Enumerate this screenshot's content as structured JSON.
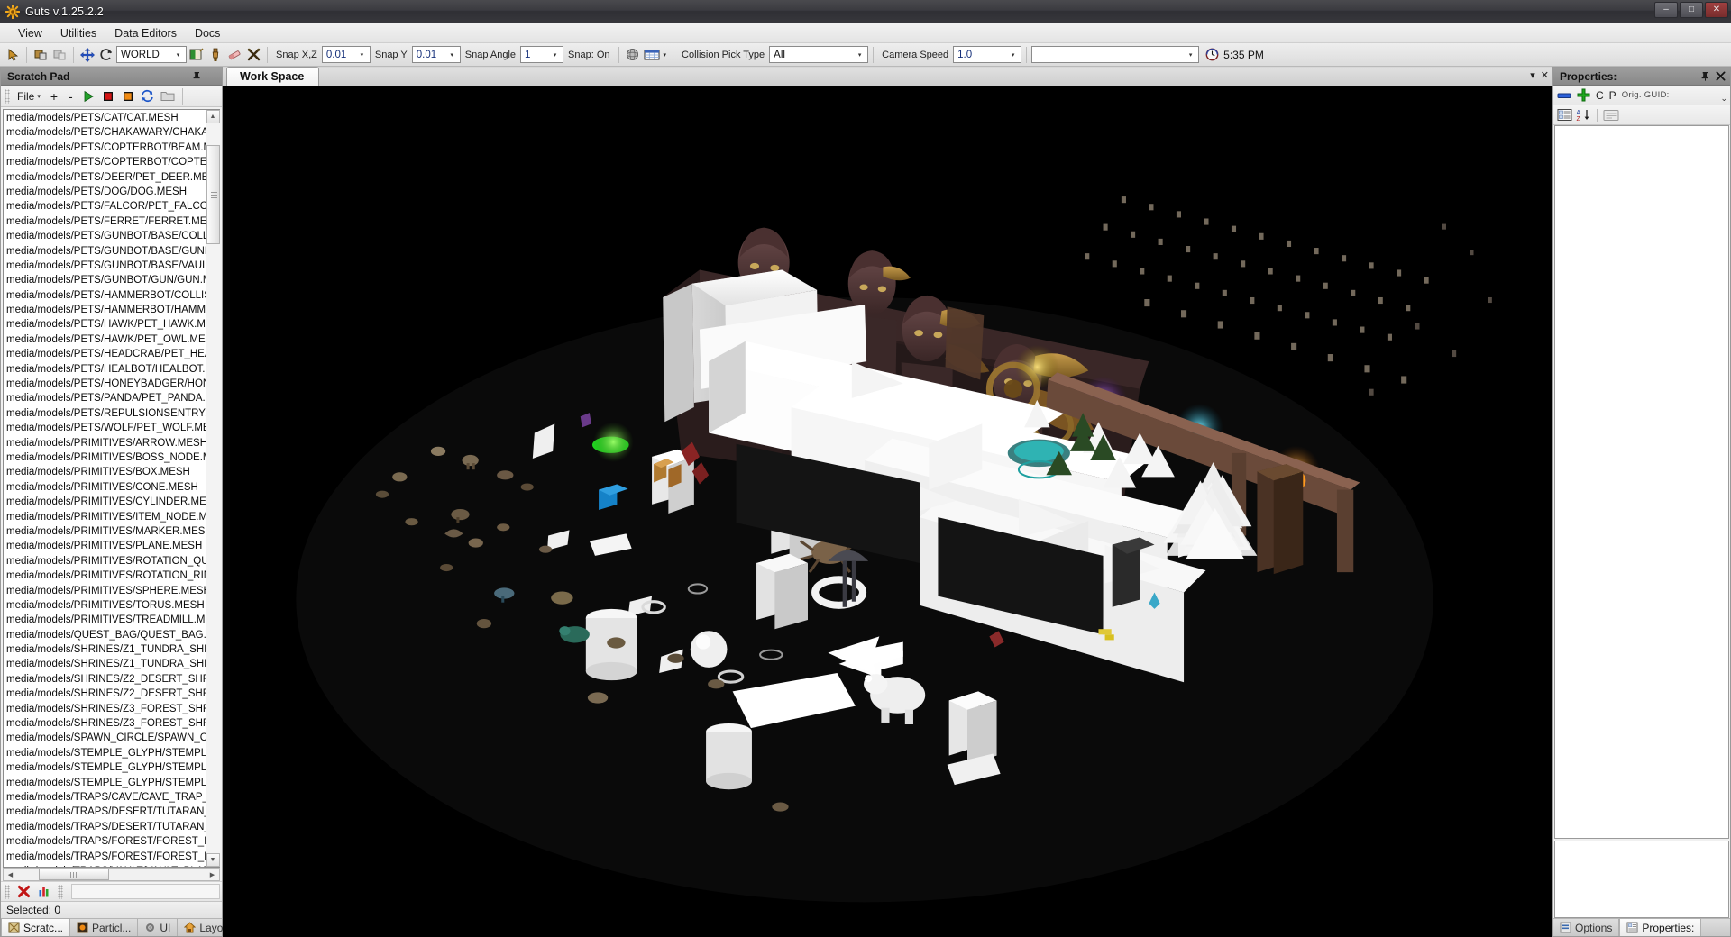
{
  "window": {
    "title": "Guts v.1.25.2.2",
    "app_icon": "gear-sun-icon",
    "minimize": "–",
    "maximize": "□",
    "close": "✕"
  },
  "menubar": {
    "items": [
      {
        "label": "View"
      },
      {
        "label": "Utilities"
      },
      {
        "label": "Data Editors"
      },
      {
        "label": "Docs"
      }
    ]
  },
  "toolbar": {
    "select_tool": "cursor-icon",
    "group_tool": "group-icon",
    "ungroup_tool": "ungroup-icon",
    "move_tool": "move-icon",
    "rotate_tool": "rotate-icon",
    "space_combo": {
      "value": "WORLD",
      "arrow": "▾"
    },
    "paint_tool": "paint-bucket-icon",
    "brush_tool": "brush-icon",
    "eraser_tool": "eraser-icon",
    "delete_tool": "scissors-x-icon",
    "snap_xz_label": "Snap X,Z",
    "snap_xz": {
      "value": "0.01",
      "arrow": "▾"
    },
    "snap_y_label": "Snap Y",
    "snap_y": {
      "value": "0.01",
      "arrow": "▾"
    },
    "snap_angle_label": "Snap Angle",
    "snap_angle": {
      "value": "1",
      "arrow": "▾"
    },
    "snap_state_label": "Snap: On",
    "sphere_tool": "sphere-icon",
    "grid_tool": "grid-icon",
    "grid_arrow": "▾",
    "collision_pick_label": "Collision Pick Type",
    "collision_pick": {
      "value": "All",
      "arrow": "▾"
    },
    "camera_speed_label": "Camera Speed",
    "camera_speed": {
      "value": "1.0",
      "arrow": "▾"
    },
    "blank_combo": {
      "value": "",
      "arrow": "▾"
    },
    "clock_icon": "clock-icon",
    "clock_time": "5:35 PM"
  },
  "scratch_pad": {
    "title": "Scratch Pad",
    "pin_icon": "pin-icon",
    "close_icon": "close-icon",
    "toolbar": {
      "file_menu": "File",
      "file_arrow": "▾",
      "add": "+",
      "remove": "-",
      "play_icon": "play-icon",
      "stop_red_icon": "stop-red-icon",
      "stop_orange_icon": "stop-orange-icon",
      "refresh_icon": "refresh-icon",
      "folder_icon": "folder-icon"
    },
    "files": [
      "media/models/PETS/CAT/CAT.MESH",
      "media/models/PETS/CHAKAWARY/CHAKAW",
      "media/models/PETS/COPTERBOT/BEAM.ME",
      "media/models/PETS/COPTERBOT/COPTER.",
      "media/models/PETS/DEER/PET_DEER.MES",
      "media/models/PETS/DOG/DOG.MESH",
      "media/models/PETS/FALCOR/PET_FALCOF",
      "media/models/PETS/FERRET/FERRET.MES",
      "media/models/PETS/GUNBOT/BASE/COLLID",
      "media/models/PETS/GUNBOT/BASE/GUNB(",
      "media/models/PETS/GUNBOT/BASE/VAULT",
      "media/models/PETS/GUNBOT/GUN/GUN.M",
      "media/models/PETS/HAMMERBOT/COLLISI",
      "media/models/PETS/HAMMERBOT/HAMMEF",
      "media/models/PETS/HAWK/PET_HAWK.MES",
      "media/models/PETS/HAWK/PET_OWL.MESH",
      "media/models/PETS/HEADCRAB/PET_HEAD",
      "media/models/PETS/HEALBOT/HEALBOT.M",
      "media/models/PETS/HONEYBADGER/HONE",
      "media/models/PETS/PANDA/PET_PANDA.M",
      "media/models/PETS/REPULSIONSENTRY/S",
      "media/models/PETS/WOLF/PET_WOLF.MES",
      "media/models/PRIMITIVES/ARROW.MESH",
      "media/models/PRIMITIVES/BOSS_NODE.ME",
      "media/models/PRIMITIVES/BOX.MESH",
      "media/models/PRIMITIVES/CONE.MESH",
      "media/models/PRIMITIVES/CYLINDER.MESH",
      "media/models/PRIMITIVES/ITEM_NODE.ME",
      "media/models/PRIMITIVES/MARKER.MESH",
      "media/models/PRIMITIVES/PLANE.MESH",
      "media/models/PRIMITIVES/ROTATION_QUA",
      "media/models/PRIMITIVES/ROTATION_RIN(",
      "media/models/PRIMITIVES/SPHERE.MESH",
      "media/models/PRIMITIVES/TORUS.MESH",
      "media/models/PRIMITIVES/TREADMILL.MES",
      "media/models/QUEST_BAG/QUEST_BAG.M",
      "media/models/SHRINES/Z1_TUNDRA_SHRI",
      "media/models/SHRINES/Z1_TUNDRA_SHRI",
      "media/models/SHRINES/Z2_DESERT_SHRII",
      "media/models/SHRINES/Z2_DESERT_SHRII",
      "media/models/SHRINES/Z3_FOREST_SHRI",
      "media/models/SHRINES/Z3_FOREST_SHRI",
      "media/models/SPAWN_CIRCLE/SPAWN_CIF",
      "media/models/STEMPLE_GLYPH/STEMPLE_",
      "media/models/STEMPLE_GLYPH/STEMPLE_",
      "media/models/STEMPLE_GLYPH/STEMPLE_",
      "media/models/TRAPS/CAVE/CAVE_TRAP_B",
      "media/models/TRAPS/DESERT/TUTARAN_T",
      "media/models/TRAPS/DESERT/TUTARAN_T",
      "media/models/TRAPS/FOREST/FOREST_M",
      "media/models/TRAPS/FOREST/FOREST_M",
      "media/models/TRAPS/VAULT/VAULT_BLADI"
    ],
    "bottom_toolbar": {
      "delete_icon": "red-x-icon",
      "chart_icon": "chart-icon"
    },
    "status": "Selected: 0"
  },
  "bottom_tabs": [
    {
      "label": "Scratc...",
      "icon": "scratchpad-icon",
      "active": true
    },
    {
      "label": "Particl...",
      "icon": "particle-icon",
      "active": false
    },
    {
      "label": "UI",
      "icon": "ui-gear-icon",
      "active": false
    },
    {
      "label": "Layout",
      "icon": "layout-house-icon",
      "active": false
    }
  ],
  "workspace": {
    "tab_label": "Work Space",
    "dropdown_icon": "▾",
    "close_icon": "✕"
  },
  "properties": {
    "title": "Properties:",
    "pin_icon": "pin-icon",
    "close_icon": "close-icon",
    "toolbar": {
      "minus_icon": "minus-blue-icon",
      "plus_icon": "plus-green-icon",
      "c_label": "C",
      "p_label": "P",
      "guid_label": "Orig. GUID:",
      "overflow_icon": "overflow-chevron-icon"
    },
    "toolbar2": {
      "categorize_icon": "categorized-view-icon",
      "sort_icon": "alpha-sort-icon",
      "pages_icon": "property-pages-icon"
    }
  },
  "status_tabs": [
    {
      "label": "Options",
      "icon": "options-icon",
      "active": false
    },
    {
      "label": "Properties:",
      "icon": "properties-icon",
      "active": true
    }
  ],
  "colors": {
    "titlebar": "#3b3b40",
    "toolbar_bg": "#e4e4e4",
    "dock_header": "#909090",
    "viewport_bg": "#000000",
    "accent_green": "#2faa2f",
    "accent_red": "#cc2222",
    "accent_orange": "#e8820c",
    "accent_blue": "#2b5fd9",
    "field_value": "#15307a"
  }
}
